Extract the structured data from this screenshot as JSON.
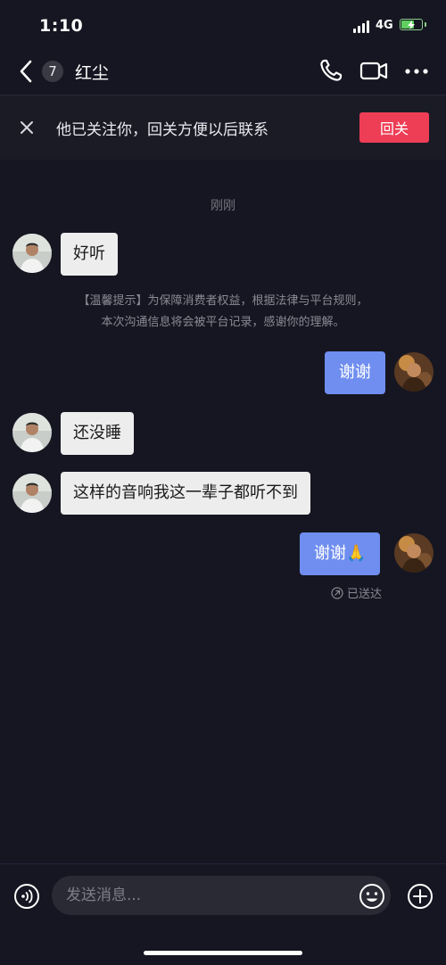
{
  "status_bar": {
    "time": "1:10",
    "network": "4G"
  },
  "header": {
    "back_count": "7",
    "contact_name": "红尘"
  },
  "banner": {
    "text": "他已关注你，回关方便以后联系",
    "follow_back_label": "回关"
  },
  "chat": {
    "timestamp": "刚刚",
    "messages": [
      {
        "direction": "in",
        "text": "好听"
      },
      {
        "direction": "out",
        "text": "谢谢"
      },
      {
        "direction": "in",
        "text": "还没睡"
      },
      {
        "direction": "in",
        "text": "这样的音响我这一辈子都听不到"
      },
      {
        "direction": "out",
        "text": "谢谢🙏"
      }
    ],
    "notice_line1": "【温馨提示】为保障消费者权益，根据法律与平台规则，",
    "notice_line2": "本次沟通信息将会被平台记录，感谢你的理解。",
    "delivered_status": "已送达"
  },
  "input": {
    "placeholder": "发送消息..."
  },
  "colors": {
    "background": "#161622",
    "follow_button": "#ee3e55",
    "outgoing_bubble": "#6f8ef0",
    "incoming_bubble": "#ededed"
  }
}
